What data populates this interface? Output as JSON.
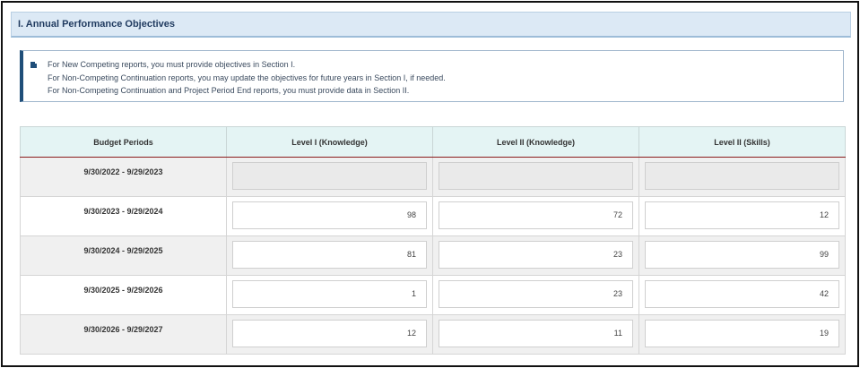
{
  "section": {
    "title": "I. Annual Performance Objectives"
  },
  "info": {
    "icon": "note-icon",
    "lines": [
      "For New Competing reports, you must provide objectives in Section I.",
      "For Non-Competing Continuation reports, you may update the objectives for future years in Section I, if needed.",
      "For Non-Competing Continuation and Project Period End reports, you must provide data in Section II."
    ]
  },
  "table": {
    "headers": [
      "Budget Periods",
      "Level I (Knowledge)",
      "Level II (Knowledge)",
      "Level II (Skills)"
    ],
    "rows": [
      {
        "period": "9/30/2022 - 9/29/2023",
        "values": [
          "",
          "",
          ""
        ],
        "disabled": true
      },
      {
        "period": "9/30/2023 - 9/29/2024",
        "values": [
          "98",
          "72",
          "12"
        ],
        "disabled": false
      },
      {
        "period": "9/30/2024 - 9/29/2025",
        "values": [
          "81",
          "23",
          "99"
        ],
        "disabled": false
      },
      {
        "period": "9/30/2025 - 9/29/2026",
        "values": [
          "1",
          "23",
          "42"
        ],
        "disabled": false
      },
      {
        "period": "9/30/2026 - 9/29/2027",
        "values": [
          "12",
          "11",
          "19"
        ],
        "disabled": false
      }
    ]
  },
  "colors": {
    "header_bg": "#dce9f5",
    "title_text": "#1f3a5f",
    "accent": "#1f4e79",
    "table_head_bg": "#e4f4f4",
    "head_rule": "#8a1c1c"
  }
}
